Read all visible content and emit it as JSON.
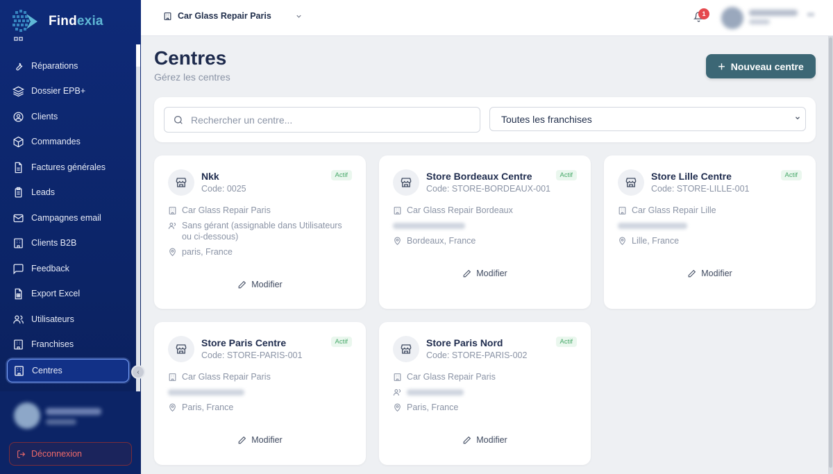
{
  "app": {
    "name_part1": "Find",
    "name_part2": "exia"
  },
  "colors": {
    "sidebar": "#0e2a78",
    "primary_button": "#3c6775",
    "active_badge_bg": "#eaf7ee",
    "active_badge_text": "#47a869",
    "notification": "#e5484d"
  },
  "sidebar": {
    "items": [
      {
        "label": "Réparations",
        "icon": "wrench-icon"
      },
      {
        "label": "Dossier EPB+",
        "icon": "layers-icon"
      },
      {
        "label": "Clients",
        "icon": "user-circle-icon"
      },
      {
        "label": "Commandes",
        "icon": "package-icon"
      },
      {
        "label": "Factures générales",
        "icon": "file-text-icon"
      },
      {
        "label": "Leads",
        "icon": "clipboard-icon"
      },
      {
        "label": "Campagnes email",
        "icon": "mail-icon"
      },
      {
        "label": "Clients B2B",
        "icon": "building-icon"
      },
      {
        "label": "Feedback",
        "icon": "message-square-icon"
      },
      {
        "label": "Export Excel",
        "icon": "file-spreadsheet-icon"
      },
      {
        "label": "Utilisateurs",
        "icon": "users-icon"
      },
      {
        "label": "Franchises",
        "icon": "building-icon"
      },
      {
        "label": "Centres",
        "icon": "building-icon",
        "active": true
      }
    ],
    "logout_label": "Déconnexion"
  },
  "topbar": {
    "franchise_selected": "Car Glass Repair Paris",
    "notification_count": "1"
  },
  "header": {
    "title": "Centres",
    "subtitle": "Gérez les centres",
    "new_button_label": "Nouveau centre"
  },
  "filters": {
    "search_placeholder": "Rechercher un centre...",
    "franchise_filter_value": "Toutes les franchises"
  },
  "cards": [
    {
      "name": "Nkk",
      "code": "Code: 0025",
      "status": "Actif",
      "franchise": "Car Glass Repair Paris",
      "manager": "Sans gérant (assignable dans Utilisateurs ou ci-dessous)",
      "location": "paris, France",
      "modify": "Modifier"
    },
    {
      "name": "Store Bordeaux Centre",
      "code": "Code: STORE-BORDEAUX-001",
      "status": "Actif",
      "franchise": "Car Glass Repair Bordeaux",
      "location": "Bordeaux, France",
      "modify": "Modifier"
    },
    {
      "name": "Store Lille Centre",
      "code": "Code: STORE-LILLE-001",
      "status": "Actif",
      "franchise": "Car Glass Repair Lille",
      "location": "Lille, France",
      "modify": "Modifier"
    },
    {
      "name": "Store Paris Centre",
      "code": "Code: STORE-PARIS-001",
      "status": "Actif",
      "franchise": "Car Glass Repair Paris",
      "location": "Paris, France",
      "modify": "Modifier"
    },
    {
      "name": "Store Paris Nord",
      "code": "Code: STORE-PARIS-002",
      "status": "Actif",
      "franchise": "Car Glass Repair Paris",
      "location": "Paris, France",
      "modify": "Modifier"
    }
  ]
}
